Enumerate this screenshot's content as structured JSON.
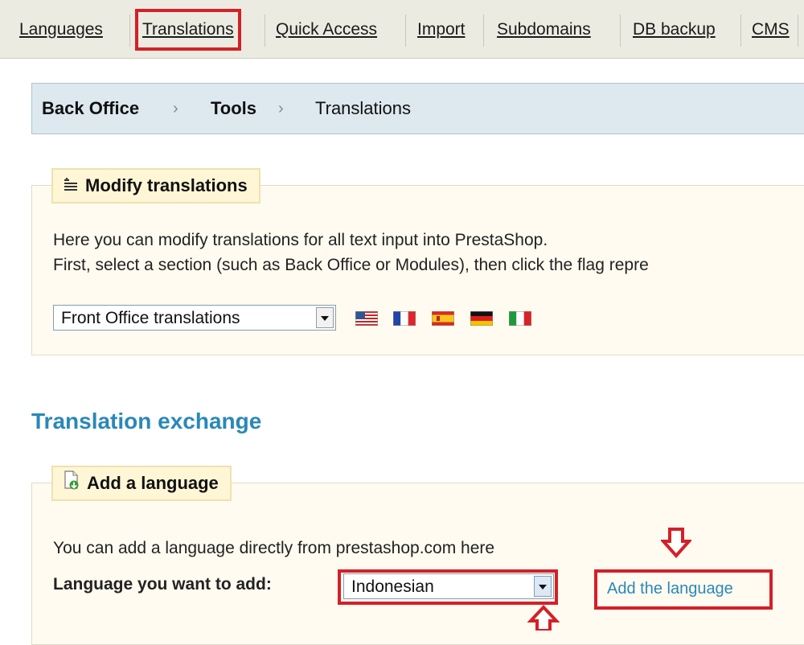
{
  "tabs": [
    {
      "label": "Languages"
    },
    {
      "label": "Translations"
    },
    {
      "label": "Quick Access"
    },
    {
      "label": "Import"
    },
    {
      "label": "Subdomains"
    },
    {
      "label": "DB backup"
    },
    {
      "label": "CMS"
    }
  ],
  "breadcrumb": {
    "items": [
      "Back Office",
      "Tools",
      "Translations"
    ],
    "separator": "›"
  },
  "modify": {
    "legend": "Modify translations",
    "line1": "Here you can modify translations for all text input into PrestaShop.",
    "line2": "First, select a section (such as Back Office or Modules), then click the flag repre",
    "select_value": "Front Office translations",
    "flags": [
      "us-flag",
      "fr-flag",
      "es-flag",
      "de-flag",
      "it-flag"
    ]
  },
  "exchange": {
    "title": "Translation exchange",
    "legend": "Add a language",
    "intro": "You can add a language directly from prestashop.com here",
    "field_label": "Language you want to add:",
    "select_value": "Indonesian",
    "button_label": "Add the language"
  },
  "colors": {
    "highlight": "#d42027",
    "link": "#2a88b8"
  }
}
